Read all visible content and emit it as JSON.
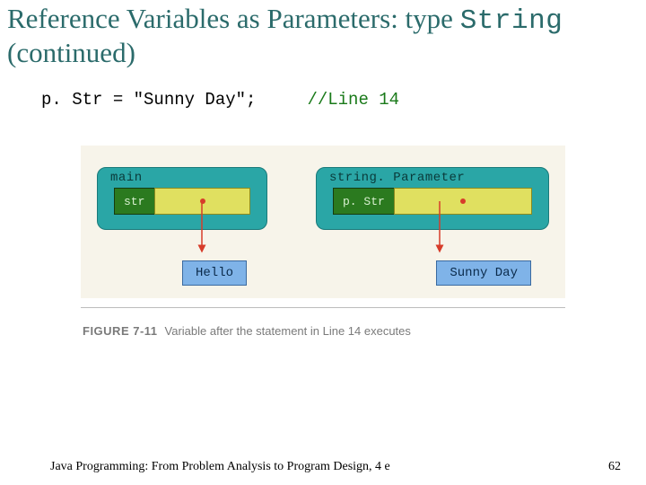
{
  "title_part1": "Reference Variables as Parameters: type ",
  "title_mono": "String",
  "title_part2": " (continued)",
  "code": {
    "stmt": "p. Str = \"Sunny Day\";     ",
    "comment": "//Line 14"
  },
  "diagram": {
    "frame_main": "main",
    "frame_param": "string. Parameter",
    "var_str": "str",
    "var_pstr": "p. Str",
    "val_hello": "Hello",
    "val_sunny": "Sunny Day"
  },
  "caption": {
    "num": "FIGURE 7-11",
    "text": "Variable after the statement in Line 14 executes"
  },
  "footer": {
    "left": "Java Programming: From Problem Analysis to Program Design, 4 e",
    "page": "62"
  }
}
